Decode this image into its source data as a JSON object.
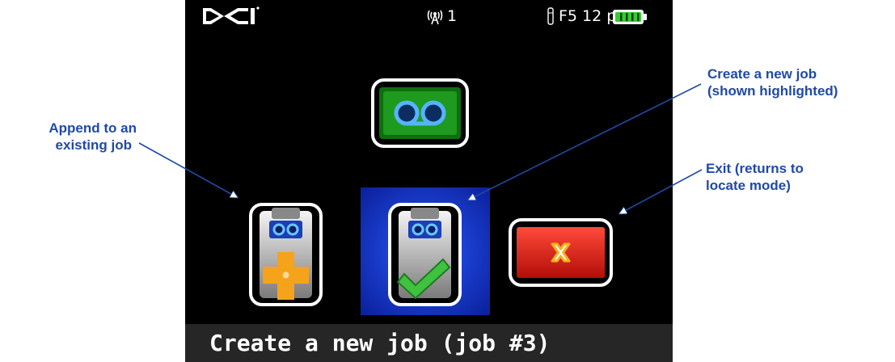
{
  "status_bar": {
    "signal_channel": "1",
    "transmitter_info": "F5 12 p"
  },
  "main": {
    "bottom_message": "Create a new job (job #3)"
  },
  "annotations": {
    "append_job": [
      "Append to an",
      "existing job"
    ],
    "create_job": [
      "Create a new job",
      "(shown highlighted)"
    ],
    "exit": [
      "Exit (returns to",
      "locate mode)"
    ]
  },
  "colors": {
    "annotation_text": "#1f4aa6",
    "highlight_blue": "#1b3fd0",
    "recorder_green": "#1e9a1e",
    "exit_red": "#d11a12",
    "plus_orange": "#f5a31a",
    "check_green": "#3fc23f",
    "battery_green": "#33cc33"
  },
  "icons": {
    "logo": "dci-logo-icon",
    "signal": "antenna-signal-icon",
    "transmitter": "transmitter-icon",
    "battery": "battery-icon",
    "job_menu": "data-logging-recorder-icon",
    "append": "append-job-icon",
    "new_job": "new-job-icon",
    "exit": "exit-icon"
  }
}
